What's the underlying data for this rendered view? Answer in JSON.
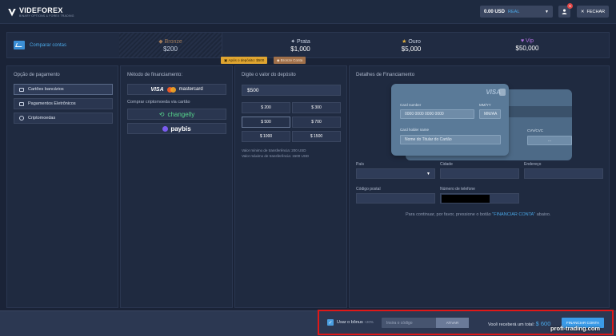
{
  "header": {
    "brand": "VIDEFOREX",
    "brand_sub": "BINARY OPTIONS & FOREX TRADING",
    "balance": "0.00 USD",
    "account_type": "REAL",
    "notification_count": "6",
    "close_label": "FECHAR"
  },
  "levels": {
    "compare_label": "Comparar contas",
    "items": [
      {
        "name": "Bronze",
        "price": "$200",
        "icon": "diamond-icon"
      },
      {
        "name": "Prata",
        "price": "$1,000",
        "icon": "star4-icon"
      },
      {
        "name": "Ouro",
        "price": "$5,000",
        "icon": "star-icon"
      },
      {
        "name": "Vip",
        "price": "$50,000",
        "icon": "heart-icon"
      }
    ],
    "after_deposit_tag": "Após o depósito: $500",
    "account_tag": "Bronze Conta"
  },
  "payment_options": {
    "title": "Opção de pagamento",
    "items": [
      "Cartões bancários",
      "Pagamentos Eletrônicos",
      "Criptomoedas"
    ]
  },
  "funding": {
    "title": "Método de financiamento:",
    "visa": "VISA",
    "mastercard": "mastercard",
    "crypto_label": "Comprar criptomoeda via cartão",
    "changelly": "changelly",
    "paybis": "paybis"
  },
  "deposit": {
    "title": "Digite o valor do depósito",
    "amount": "$500",
    "presets": [
      "$ 200",
      "$ 300",
      "$ 500",
      "$ 700",
      "$ 1000",
      "$ 1500"
    ],
    "selected": "$ 500",
    "min_text": "Valor mínimo de transferência: 200 USD",
    "max_text": "Valor máximo de transferência: 1500 USD"
  },
  "details": {
    "title": "Detalhes de Financiamento",
    "card": {
      "brand": "VISA",
      "number_label": "Card number",
      "number_placeholder": "0000 0000 0000 0000",
      "expiry_label": "MM/YY",
      "expiry_placeholder": "MM/AA",
      "holder_label": "Card holder name",
      "holder_placeholder": "Nome do Titular do Cartão",
      "cvv_label": "CVV/CVC",
      "cvv_placeholder": "..."
    },
    "fields": {
      "country": "País",
      "city": "Cidade",
      "address": "Endereço",
      "postal": "Código postal",
      "phone": "Número de telefone"
    },
    "hint_prefix": "Para continuar, por favor, pressione o botão",
    "hint_button": "\"FINANCIAR CONTA\"",
    "hint_suffix": "abaixo."
  },
  "footer": {
    "bonus_label": "Usar o bônus",
    "bonus_pct": "+20%",
    "code_placeholder": "Insira o código",
    "apply_label": "ATIVAR",
    "total_label": "Você receberá um total:",
    "total_amount": "$ 600",
    "fund_button": "FINANCIAR CONTA"
  },
  "watermark": "profi-trading.com"
}
